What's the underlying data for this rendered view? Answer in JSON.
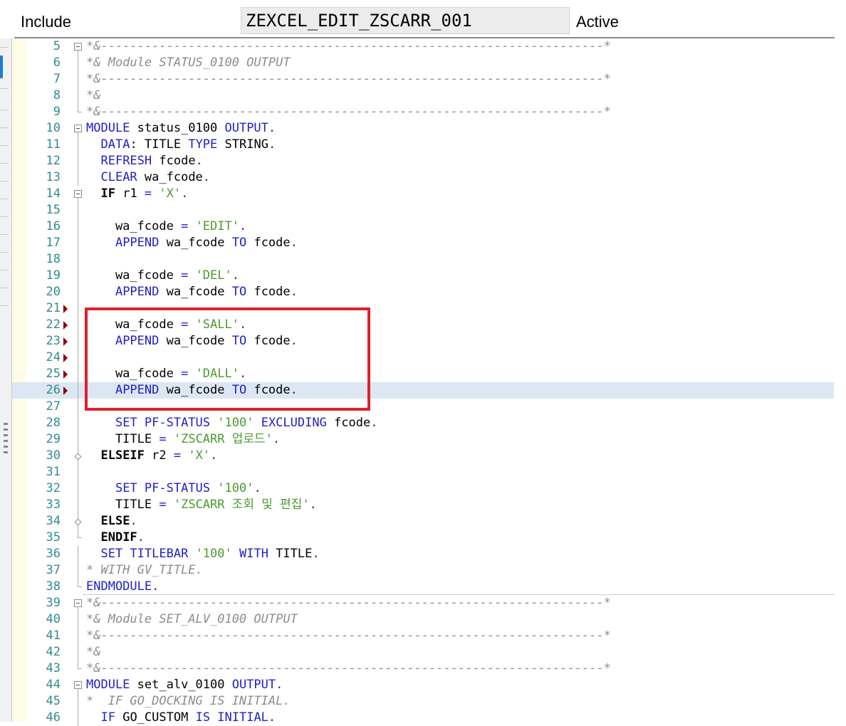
{
  "header": {
    "label": "Include",
    "name": "ZEXCEL_EDIT_ZSCARR_001",
    "status": "Active"
  },
  "colors": {
    "keyword": "#2020c8",
    "string": "#4b9a2e",
    "comment": "#8c8c8c",
    "line_number": "#2e8b91",
    "highlight_box": "#e0202a",
    "current_line": "#dce7f3"
  },
  "lines": [
    {
      "n": "5",
      "fold": "box",
      "marker": false,
      "current": false,
      "parts": [
        {
          "t": "*&---------------------------------------------------------------------*",
          "c": "cm"
        }
      ]
    },
    {
      "n": "6",
      "fold": "line",
      "marker": false,
      "current": false,
      "parts": [
        {
          "t": "*& Module STATUS_0100 OUTPUT",
          "c": "cm"
        }
      ]
    },
    {
      "n": "7",
      "fold": "line",
      "marker": false,
      "current": false,
      "parts": [
        {
          "t": "*&---------------------------------------------------------------------*",
          "c": "cm"
        }
      ]
    },
    {
      "n": "8",
      "fold": "line",
      "marker": false,
      "current": false,
      "parts": [
        {
          "t": "*&",
          "c": "cm"
        }
      ]
    },
    {
      "n": "9",
      "fold": "end",
      "marker": false,
      "current": false,
      "parts": [
        {
          "t": "*&---------------------------------------------------------------------*",
          "c": "cm"
        }
      ]
    },
    {
      "n": "10",
      "fold": "box",
      "marker": false,
      "current": false,
      "parts": [
        {
          "t": "MODULE",
          "c": "kw"
        },
        {
          "t": " status_0100 ",
          "c": "tx"
        },
        {
          "t": "OUTPUT",
          "c": "kw"
        },
        {
          "t": ".",
          "c": "pn"
        }
      ]
    },
    {
      "n": "11",
      "fold": "line",
      "marker": false,
      "current": false,
      "parts": [
        {
          "t": "  ",
          "c": "tx"
        },
        {
          "t": "DATA",
          "c": "kw"
        },
        {
          "t": ": TITLE ",
          "c": "tx"
        },
        {
          "t": "TYPE",
          "c": "kw"
        },
        {
          "t": " STRING",
          "c": "tx"
        },
        {
          "t": ".",
          "c": "pn"
        }
      ]
    },
    {
      "n": "12",
      "fold": "line",
      "marker": false,
      "current": false,
      "parts": [
        {
          "t": "  ",
          "c": "tx"
        },
        {
          "t": "REFRESH",
          "c": "kw"
        },
        {
          "t": " fcode",
          "c": "tx"
        },
        {
          "t": ".",
          "c": "pn"
        }
      ]
    },
    {
      "n": "13",
      "fold": "line",
      "marker": false,
      "current": false,
      "parts": [
        {
          "t": "  ",
          "c": "tx"
        },
        {
          "t": "CLEAR",
          "c": "kw"
        },
        {
          "t": " wa_fcode",
          "c": "tx"
        },
        {
          "t": ".",
          "c": "pn"
        }
      ]
    },
    {
      "n": "14",
      "fold": "box",
      "marker": false,
      "current": false,
      "parts": [
        {
          "t": "  ",
          "c": "tx"
        },
        {
          "t": "IF",
          "c": "kwb"
        },
        {
          "t": " r1 ",
          "c": "tx"
        },
        {
          "t": "=",
          "c": "kw"
        },
        {
          "t": " ",
          "c": "tx"
        },
        {
          "t": "'X'",
          "c": "st"
        },
        {
          "t": ".",
          "c": "pn"
        }
      ]
    },
    {
      "n": "15",
      "fold": "line",
      "marker": false,
      "current": false,
      "parts": []
    },
    {
      "n": "16",
      "fold": "line",
      "marker": false,
      "current": false,
      "parts": [
        {
          "t": "    wa_fcode ",
          "c": "tx"
        },
        {
          "t": "=",
          "c": "kw"
        },
        {
          "t": " ",
          "c": "tx"
        },
        {
          "t": "'EDIT'",
          "c": "st"
        },
        {
          "t": ".",
          "c": "pn"
        }
      ]
    },
    {
      "n": "17",
      "fold": "line",
      "marker": false,
      "current": false,
      "parts": [
        {
          "t": "    ",
          "c": "tx"
        },
        {
          "t": "APPEND",
          "c": "kw"
        },
        {
          "t": " wa_fcode ",
          "c": "tx"
        },
        {
          "t": "TO",
          "c": "kw"
        },
        {
          "t": " fcode",
          "c": "tx"
        },
        {
          "t": ".",
          "c": "pn"
        }
      ]
    },
    {
      "n": "18",
      "fold": "line",
      "marker": false,
      "current": false,
      "parts": []
    },
    {
      "n": "19",
      "fold": "line",
      "marker": false,
      "current": false,
      "parts": [
        {
          "t": "    wa_fcode ",
          "c": "tx"
        },
        {
          "t": "=",
          "c": "kw"
        },
        {
          "t": " ",
          "c": "tx"
        },
        {
          "t": "'DEL'",
          "c": "st"
        },
        {
          "t": ".",
          "c": "pn"
        }
      ]
    },
    {
      "n": "20",
      "fold": "line",
      "marker": false,
      "current": false,
      "parts": [
        {
          "t": "    ",
          "c": "tx"
        },
        {
          "t": "APPEND",
          "c": "kw"
        },
        {
          "t": " wa_fcode ",
          "c": "tx"
        },
        {
          "t": "TO",
          "c": "kw"
        },
        {
          "t": " fcode",
          "c": "tx"
        },
        {
          "t": ".",
          "c": "pn"
        }
      ]
    },
    {
      "n": "21",
      "fold": "line",
      "marker": true,
      "current": false,
      "parts": []
    },
    {
      "n": "22",
      "fold": "line",
      "marker": true,
      "current": false,
      "parts": [
        {
          "t": "    wa_fcode ",
          "c": "tx"
        },
        {
          "t": "=",
          "c": "kw"
        },
        {
          "t": " ",
          "c": "tx"
        },
        {
          "t": "'SALL'",
          "c": "st"
        },
        {
          "t": ".",
          "c": "pn"
        }
      ]
    },
    {
      "n": "23",
      "fold": "line",
      "marker": true,
      "current": false,
      "parts": [
        {
          "t": "    ",
          "c": "tx"
        },
        {
          "t": "APPEND",
          "c": "kw"
        },
        {
          "t": " wa_fcode ",
          "c": "tx"
        },
        {
          "t": "TO",
          "c": "kw"
        },
        {
          "t": " fcode",
          "c": "tx"
        },
        {
          "t": ".",
          "c": "pn"
        }
      ]
    },
    {
      "n": "24",
      "fold": "line",
      "marker": true,
      "current": false,
      "parts": []
    },
    {
      "n": "25",
      "fold": "line",
      "marker": true,
      "current": false,
      "parts": [
        {
          "t": "    wa_fcode ",
          "c": "tx"
        },
        {
          "t": "=",
          "c": "kw"
        },
        {
          "t": " ",
          "c": "tx"
        },
        {
          "t": "'DALL'",
          "c": "st"
        },
        {
          "t": ".",
          "c": "pn"
        }
      ]
    },
    {
      "n": "26",
      "fold": "line",
      "marker": true,
      "current": true,
      "parts": [
        {
          "t": "    ",
          "c": "tx"
        },
        {
          "t": "APPEND",
          "c": "kw"
        },
        {
          "t": " wa_fcode ",
          "c": "tx"
        },
        {
          "t": "TO",
          "c": "kw"
        },
        {
          "t": " fcode",
          "c": "tx"
        },
        {
          "t": ".",
          "c": "pn"
        }
      ]
    },
    {
      "n": "27",
      "fold": "line",
      "marker": false,
      "current": false,
      "parts": []
    },
    {
      "n": "28",
      "fold": "line",
      "marker": false,
      "current": false,
      "parts": [
        {
          "t": "    ",
          "c": "tx"
        },
        {
          "t": "SET PF-STATUS",
          "c": "kw"
        },
        {
          "t": " ",
          "c": "tx"
        },
        {
          "t": "'100'",
          "c": "st"
        },
        {
          "t": " ",
          "c": "tx"
        },
        {
          "t": "EXCLUDING",
          "c": "kw"
        },
        {
          "t": " fcode",
          "c": "tx"
        },
        {
          "t": ".",
          "c": "pn"
        }
      ]
    },
    {
      "n": "29",
      "fold": "line",
      "marker": false,
      "current": false,
      "parts": [
        {
          "t": "    TITLE ",
          "c": "tx"
        },
        {
          "t": "=",
          "c": "kw"
        },
        {
          "t": " ",
          "c": "tx"
        },
        {
          "t": "'ZSCARR 업로드'",
          "c": "st"
        },
        {
          "t": ".",
          "c": "pn"
        }
      ]
    },
    {
      "n": "30",
      "fold": "diamond",
      "marker": false,
      "current": false,
      "parts": [
        {
          "t": "  ",
          "c": "tx"
        },
        {
          "t": "ELSEIF",
          "c": "kwb"
        },
        {
          "t": " r2 ",
          "c": "tx"
        },
        {
          "t": "=",
          "c": "kw"
        },
        {
          "t": " ",
          "c": "tx"
        },
        {
          "t": "'X'",
          "c": "st"
        },
        {
          "t": ".",
          "c": "pn"
        }
      ]
    },
    {
      "n": "31",
      "fold": "line",
      "marker": false,
      "current": false,
      "parts": []
    },
    {
      "n": "32",
      "fold": "line",
      "marker": false,
      "current": false,
      "parts": [
        {
          "t": "    ",
          "c": "tx"
        },
        {
          "t": "SET PF-STATUS",
          "c": "kw"
        },
        {
          "t": " ",
          "c": "tx"
        },
        {
          "t": "'100'",
          "c": "st"
        },
        {
          "t": ".",
          "c": "pn"
        }
      ]
    },
    {
      "n": "33",
      "fold": "line",
      "marker": false,
      "current": false,
      "parts": [
        {
          "t": "    TITLE ",
          "c": "tx"
        },
        {
          "t": "=",
          "c": "kw"
        },
        {
          "t": " ",
          "c": "tx"
        },
        {
          "t": "'ZSCARR 조회 및 편집'",
          "c": "st"
        },
        {
          "t": ".",
          "c": "pn"
        }
      ]
    },
    {
      "n": "34",
      "fold": "diamond",
      "marker": false,
      "current": false,
      "parts": [
        {
          "t": "  ",
          "c": "tx"
        },
        {
          "t": "ELSE",
          "c": "kwb"
        },
        {
          "t": ".",
          "c": "pn"
        }
      ]
    },
    {
      "n": "35",
      "fold": "end",
      "marker": false,
      "current": false,
      "parts": [
        {
          "t": "  ",
          "c": "tx"
        },
        {
          "t": "ENDIF",
          "c": "kwb"
        },
        {
          "t": ".",
          "c": "pn"
        }
      ]
    },
    {
      "n": "36",
      "fold": "line",
      "marker": false,
      "current": false,
      "parts": [
        {
          "t": "  ",
          "c": "tx"
        },
        {
          "t": "SET TITLEBAR",
          "c": "kw"
        },
        {
          "t": " ",
          "c": "tx"
        },
        {
          "t": "'100'",
          "c": "st"
        },
        {
          "t": " ",
          "c": "tx"
        },
        {
          "t": "WITH",
          "c": "kw"
        },
        {
          "t": " TITLE",
          "c": "tx"
        },
        {
          "t": ".",
          "c": "pn"
        }
      ]
    },
    {
      "n": "37",
      "fold": "line",
      "marker": false,
      "current": false,
      "parts": [
        {
          "t": "* WITH GV_TITLE.",
          "c": "cm"
        }
      ]
    },
    {
      "n": "38",
      "fold": "end",
      "marker": false,
      "current": false,
      "parts": [
        {
          "t": "ENDMODULE",
          "c": "kw"
        },
        {
          "t": ".",
          "c": "pn"
        }
      ]
    },
    {
      "n": "39",
      "fold": "box",
      "marker": false,
      "current": false,
      "parts": [
        {
          "t": "*&---------------------------------------------------------------------*",
          "c": "cm"
        }
      ]
    },
    {
      "n": "40",
      "fold": "line",
      "marker": false,
      "current": false,
      "parts": [
        {
          "t": "*& Module SET_ALV_0100 OUTPUT",
          "c": "cm"
        }
      ]
    },
    {
      "n": "41",
      "fold": "line",
      "marker": false,
      "current": false,
      "parts": [
        {
          "t": "*&---------------------------------------------------------------------*",
          "c": "cm"
        }
      ]
    },
    {
      "n": "42",
      "fold": "line",
      "marker": false,
      "current": false,
      "parts": [
        {
          "t": "*&",
          "c": "cm"
        }
      ]
    },
    {
      "n": "43",
      "fold": "end",
      "marker": false,
      "current": false,
      "parts": [
        {
          "t": "*&---------------------------------------------------------------------*",
          "c": "cm"
        }
      ]
    },
    {
      "n": "44",
      "fold": "box",
      "marker": false,
      "current": false,
      "parts": [
        {
          "t": "MODULE",
          "c": "kw"
        },
        {
          "t": " set_alv_0100 ",
          "c": "tx"
        },
        {
          "t": "OUTPUT",
          "c": "kw"
        },
        {
          "t": ".",
          "c": "pn"
        }
      ]
    },
    {
      "n": "45",
      "fold": "line",
      "marker": false,
      "current": false,
      "parts": [
        {
          "t": "*  IF GO_DOCKING IS INITIAL.",
          "c": "cm"
        }
      ]
    },
    {
      "n": "46",
      "fold": "line",
      "marker": false,
      "current": false,
      "parts": [
        {
          "t": "  ",
          "c": "tx"
        },
        {
          "t": "IF",
          "c": "kw"
        },
        {
          "t": " GO_CUSTOM ",
          "c": "tx"
        },
        {
          "t": "IS INITIAL",
          "c": "kw"
        },
        {
          "t": ".",
          "c": "pn"
        }
      ]
    }
  ]
}
